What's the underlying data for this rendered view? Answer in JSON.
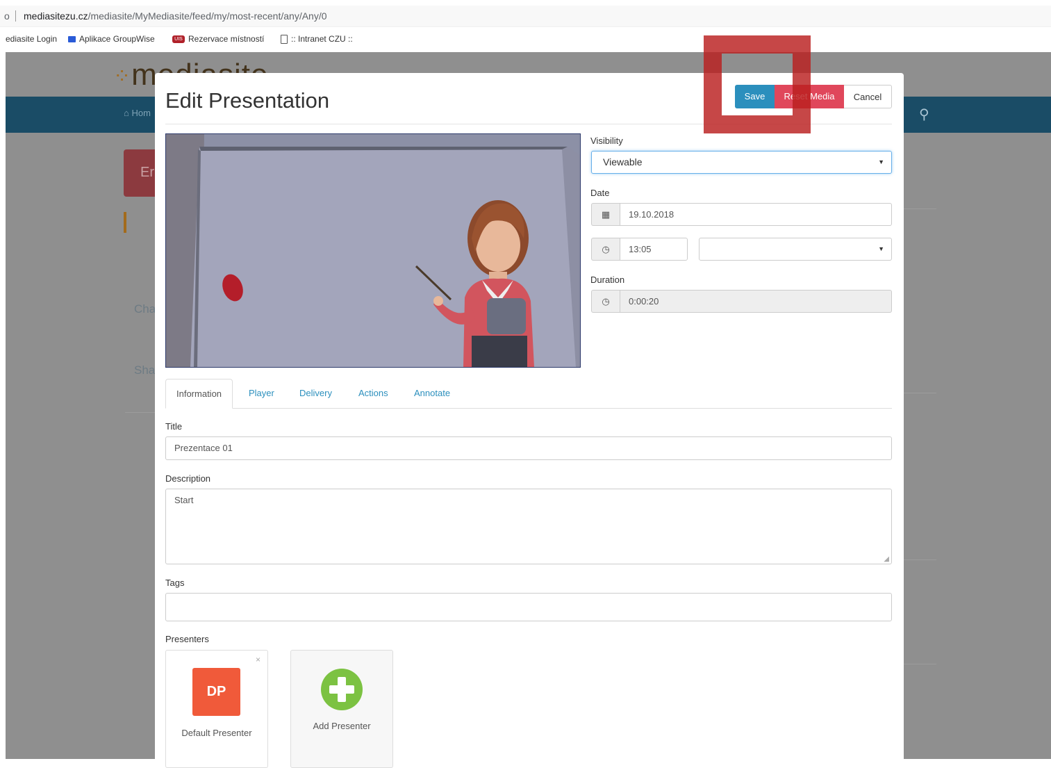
{
  "browser": {
    "lead_char": "o",
    "url_host": "mediasitezu.cz",
    "url_path": "/mediasite/MyMediasite/feed/my/most-recent/any/Any/0",
    "bookmarks": [
      "ediasite Login",
      "Aplikace GroupWise",
      "Rezervace místností",
      ":: Intranet CZU ::"
    ]
  },
  "background_app": {
    "logo_text": "mediasite",
    "nav_home": "Hom",
    "tile_text": "Er",
    "side_texts": [
      "Cha",
      "Sha"
    ]
  },
  "modal": {
    "title": "Edit Presentation",
    "buttons": {
      "save": "Save",
      "reset_media": "Reset Media",
      "cancel": "Cancel"
    },
    "visibility": {
      "label": "Visibility",
      "value": "Viewable"
    },
    "date": {
      "label": "Date",
      "value": "19.10.2018"
    },
    "time": {
      "value": "13:05",
      "timezone_value": ""
    },
    "duration": {
      "label": "Duration",
      "value": "0:00:20"
    },
    "tabs": [
      "Information",
      "Player",
      "Delivery",
      "Actions",
      "Annotate"
    ],
    "active_tab": "Information",
    "title_field": {
      "label": "Title",
      "value": "Prezentace 01"
    },
    "description_field": {
      "label": "Description",
      "value": "Start"
    },
    "tags_field": {
      "label": "Tags",
      "value": ""
    },
    "presenters": {
      "label": "Presenters",
      "items": [
        {
          "initials": "DP",
          "name": "Default Presenter",
          "color": "#f05a3a"
        }
      ],
      "add_label": "Add Presenter",
      "remove_symbol": "×"
    }
  },
  "colors": {
    "save": "#2b8fbd",
    "reset": "#e0475b",
    "highlight": "#b91e1e",
    "nav": "#1a4c66",
    "add": "#7cc242"
  }
}
